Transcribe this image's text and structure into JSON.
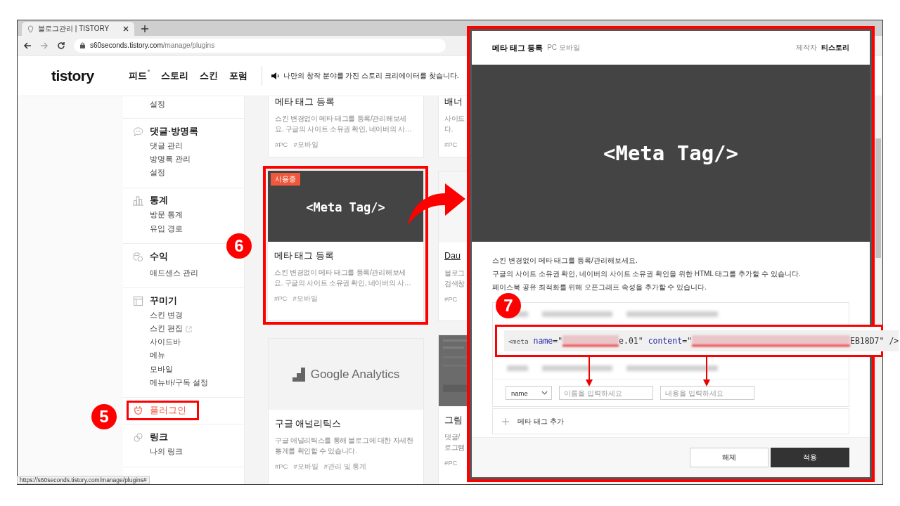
{
  "browser": {
    "tab_title": "블로그관리 | TISTORY",
    "url_host": "s60seconds.tistory.com",
    "url_path": "/manage/plugins",
    "status_url": "https://s60seconds.tistory.com/manage/plugins#"
  },
  "header": {
    "logo": "tistory",
    "nav": [
      {
        "label": "피드",
        "new": true
      },
      {
        "label": "스토리",
        "new": false
      },
      {
        "label": "스킨",
        "new": false
      },
      {
        "label": "포럼",
        "new": false
      }
    ],
    "notice": "나만의 창작 분야를 가진 스토리 크리에이터를 찾습니다."
  },
  "sidebar": {
    "groups": [
      {
        "items": [
          {
            "label": "설정",
            "external": false
          }
        ]
      },
      {
        "kind": "comment",
        "title": "댓글·방명록",
        "selected": false,
        "annotated": false,
        "items": [
          {
            "label": "댓글 관리",
            "external": false
          },
          {
            "label": "방명록 관리",
            "external": false
          },
          {
            "label": "설정",
            "external": false
          }
        ]
      },
      {
        "kind": "chart",
        "title": "통계",
        "selected": false,
        "annotated": false,
        "items": [
          {
            "label": "방문 통계",
            "external": false
          },
          {
            "label": "유입 경로",
            "external": false
          }
        ]
      },
      {
        "kind": "coins",
        "title": "수익",
        "selected": false,
        "annotated": false,
        "items": [
          {
            "label": "애드센스 관리",
            "external": false
          }
        ]
      },
      {
        "kind": "layout",
        "title": "꾸미기",
        "selected": false,
        "annotated": false,
        "items": [
          {
            "label": "스킨 변경",
            "external": false
          },
          {
            "label": "스킨 편집",
            "external": true
          },
          {
            "label": "사이드바",
            "external": false
          },
          {
            "label": "메뉴",
            "external": false
          },
          {
            "label": "모바일",
            "external": false
          },
          {
            "label": "메뉴바/구독 설정",
            "external": false
          }
        ]
      },
      {
        "kind": "plug",
        "title": "플러그인",
        "selected": true,
        "annotated": true
      },
      {
        "kind": "link",
        "title": "링크",
        "selected": false,
        "annotated": false,
        "items": [
          {
            "label": "나의 링크",
            "external": false
          }
        ]
      }
    ]
  },
  "cards": [
    [
      {
        "kind": "none",
        "title": "메타 태그 등록",
        "link_title": false,
        "annotated": false,
        "desc": [
          "스킨 변경없이 메타 태그를 등록/관리해보세",
          "요. 구글의 사이트 소유권 확인, 네이버의 사…"
        ],
        "tags": [
          "#PC",
          "#모바일"
        ]
      },
      {
        "kind": "dark-title",
        "image_text": "<Meta Tag/>",
        "badge": "사용중",
        "title": "메타 태그 등록",
        "link_title": false,
        "annotated": true,
        "desc": [
          "스킨 변경없이 메타 태그를 등록/관리해보세",
          "요. 구글의 사이트 소유권 확인, 네이버의 사…"
        ],
        "tags": [
          "#PC",
          "#모바일"
        ]
      },
      {
        "kind": "logo",
        "image_text": "Google Analytics",
        "title": "구글 애널리틱스",
        "link_title": false,
        "annotated": false,
        "desc": [
          "구글 애널리틱스를 통해 블로그에 대한 자세한",
          "통계를 확인할 수 있습니다."
        ],
        "tags": [
          "#PC",
          "#모바일",
          "#관리 및 통계"
        ]
      }
    ],
    [
      {
        "kind": "none",
        "title": "배너",
        "link_title": false,
        "annotated": false,
        "desc": [
          "사이드",
          "다."
        ],
        "tags": [
          "#PC"
        ]
      },
      {
        "kind": "blank",
        "title": "Dau",
        "link_title": true,
        "annotated": false,
        "desc": [
          "블로그",
          "검색창"
        ],
        "tags": [
          "#PC"
        ]
      },
      {
        "kind": "screenshot",
        "title": "그림",
        "link_title": false,
        "annotated": false,
        "desc": [
          "댓글/",
          "로그램"
        ],
        "tags": [
          "#PC"
        ]
      }
    ]
  ],
  "modal": {
    "title": "메타 태그 등록",
    "platforms": "PC 모바일",
    "maker_label": "제작자",
    "maker": "티스토리",
    "hero_text": "<Meta Tag/>",
    "description": [
      "스킨 변경없이 메타 태그를 등록/관리해보세요.",
      "구글의 사이트 소유권 확인, 네이버의 사이트 소유권 확인을 위한 HTML 태그를 추가할 수 있습니다.",
      "페이스북 공유 최적화를 위해 오픈그래프 속성을 추가할 수 있습니다."
    ],
    "code": [
      {
        "kind": "tag",
        "text": "<meta"
      },
      {
        "kind": "attr",
        "text": " name"
      },
      {
        "kind": "punct",
        "text": "=\""
      },
      {
        "kind": "redacted"
      },
      {
        "kind": "value",
        "text": "e.01"
      },
      {
        "kind": "punct",
        "text": "\""
      },
      {
        "kind": "attr",
        "text": " content"
      },
      {
        "kind": "punct",
        "text": "=\""
      },
      {
        "kind": "redacted"
      },
      {
        "kind": "value",
        "text": "EB18D7"
      },
      {
        "kind": "punct",
        "text": "\" />"
      }
    ],
    "select": "name",
    "name_placeholder": "이름을 입력하세요",
    "content_placeholder": "내용을 입력하세요",
    "add_label": "메타 태그 추가",
    "buttons": [
      {
        "label": "해제",
        "kind": "secondary"
      },
      {
        "label": "적용",
        "kind": "primary"
      }
    ]
  },
  "annotations": [
    {
      "label": "5"
    },
    {
      "label": "6"
    },
    {
      "label": "7"
    }
  ]
}
